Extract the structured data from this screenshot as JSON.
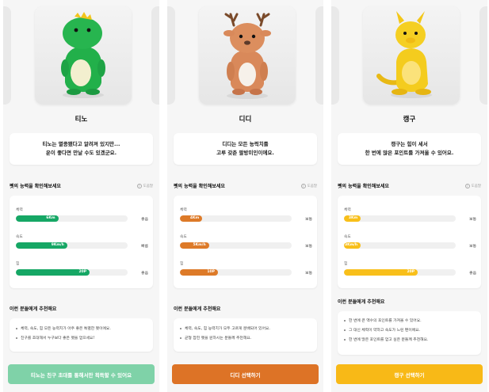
{
  "colors": {
    "green": "#16a765",
    "orange": "#dd7a28",
    "yellow": "#f8bf1a",
    "green_cta": "#7fd2a8",
    "orange_cta": "#dd7326",
    "yellow_cta": "#f8b917"
  },
  "screens": [
    {
      "name": "티노",
      "desc_line1": "티노는 멸종됐다고 알려져 있지만...",
      "desc_line2": "운이 좋다면 만날 수도 있겠군요.",
      "stat_title": "펫의 능력을 확인해보세요",
      "help": "도움말",
      "stats": [
        {
          "label": "체력",
          "value": "6Km",
          "grade": "좋음",
          "level": 0.38
        },
        {
          "label": "속도",
          "value": "9Km/h",
          "grade": "빠름",
          "level": 0.46
        },
        {
          "label": "힘",
          "value": "20P",
          "grade": "좋음",
          "level": 0.66
        }
      ],
      "rec_title": "이런 분들에게 추천해요",
      "rec_items": [
        "체력, 속도, 힘 모든 능력치가 아주 좋은 특별한 펫이에요.",
        "친구를 초대해서 누구보다 좋은 펫을 얻으세요!"
      ],
      "cta": "티노는 친구 초대를 통해서만 획득할 수 있어요"
    },
    {
      "name": "디디",
      "desc_line1": "디디는 모든 능력치를",
      "desc_line2": "고루 갖춘 팔방미인이에요.",
      "stat_title": "펫의 능력을 확인해보세요",
      "help": "도움말",
      "stats": [
        {
          "label": "체력",
          "value": "4Km",
          "grade": "보통",
          "level": 0.2
        },
        {
          "label": "속도",
          "value": "5Km/h",
          "grade": "보통",
          "level": 0.26
        },
        {
          "label": "힘",
          "value": "10P",
          "grade": "보통",
          "level": 0.34
        }
      ],
      "rec_title": "이런 분들에게 추천해요",
      "rec_items": [
        "체력, 속도, 힘 능력치가 모두 고르게 분배되어 있어요.",
        "균형 잡힌 펫을 원하시는 분들께 추천해요."
      ],
      "cta": "디디 선택하기"
    },
    {
      "name": "캥구",
      "desc_line1": "캥구는 힘이 세서",
      "desc_line2": "한 번에 많은 포인트를 가져올 수 있어요.",
      "stat_title": "펫의 능력을 확인해보세요",
      "help": "도움말",
      "stats": [
        {
          "label": "체력",
          "value": "3Km",
          "grade": "보통",
          "level": 0.15
        },
        {
          "label": "속도",
          "value": "3Km/h",
          "grade": "보통",
          "level": 0.15
        },
        {
          "label": "힘",
          "value": "20P",
          "grade": "좋음",
          "level": 0.66
        }
      ],
      "rec_title": "이런 분들에게 추천해요",
      "rec_items": [
        "한 번에 큰 액수의 포인트를 가져올 수 있어요.",
        "그 대신 체력이 약하고 속도가 느린 편이에요.",
        "한 번에 많은 포인트를 얻고 싶은 분들께 추천해요."
      ],
      "cta": "캥구 선택하기"
    }
  ]
}
